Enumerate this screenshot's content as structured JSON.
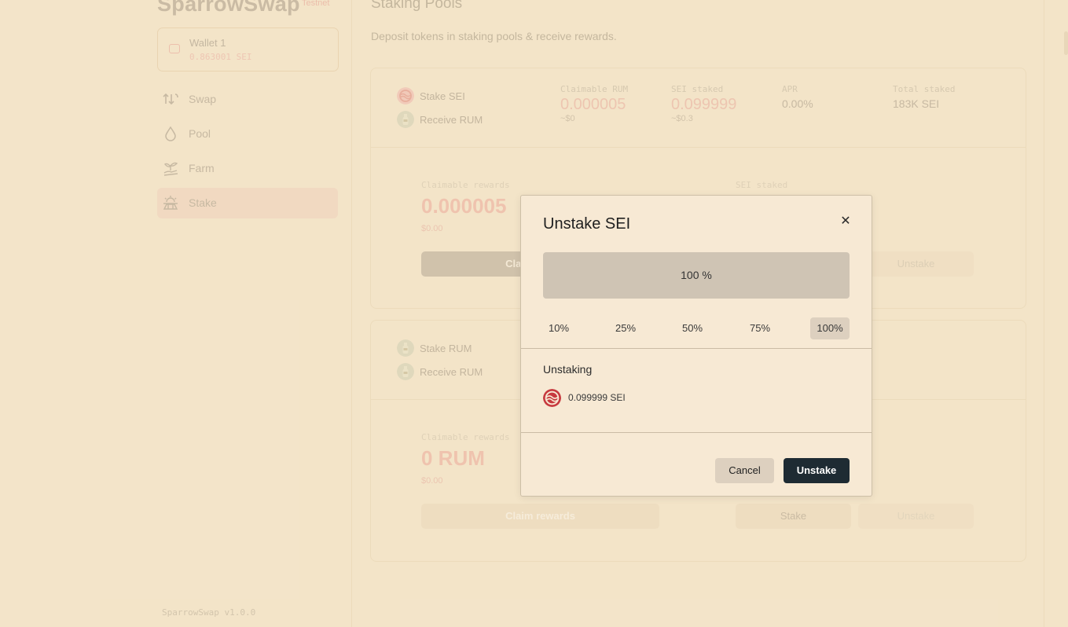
{
  "app": {
    "name": "SparrowSwap",
    "tag": "Testnet",
    "version": "SparrowSwap v1.0.0"
  },
  "wallet": {
    "name": "Wallet 1",
    "balance": "0.863001 SEI"
  },
  "nav": [
    {
      "label": "Swap",
      "icon": "swap-icon"
    },
    {
      "label": "Pool",
      "icon": "droplet-icon"
    },
    {
      "label": "Farm",
      "icon": "sprout-icon"
    },
    {
      "label": "Stake",
      "icon": "stake-icon",
      "active": true
    }
  ],
  "page": {
    "title": "Staking Pools",
    "subtitle": "Deposit tokens in staking pools & receive rewards."
  },
  "pools": [
    {
      "stake_label": "Stake SEI",
      "receive_label": "Receive RUM",
      "stats": {
        "claimable_key": "Claimable RUM",
        "claimable_val": "0.000005",
        "claimable_usd": "~$0",
        "staked_key": "SEI staked",
        "staked_val": "0.099999",
        "staked_usd": "~$0.3",
        "apr_key": "APR",
        "apr_val": "0.00%",
        "total_key": "Total staked",
        "total_val": "183K SEI"
      },
      "detail": {
        "claim_label": "Claimable rewards",
        "claim_val": "0.000005",
        "claim_usd": "$0.00",
        "staked_label": "SEI staked",
        "claim_btn": "Claim rewards",
        "unstake_btn": "Unstake"
      }
    },
    {
      "stake_label": "Stake RUM",
      "receive_label": "Receive RUM",
      "detail": {
        "claim_label": "Claimable rewards",
        "claim_val": "0 RUM",
        "claim_usd": "$0.00",
        "claim_btn": "Claim rewards",
        "stake_btn": "Stake",
        "unstake_btn": "Unstake"
      }
    }
  ],
  "modal": {
    "title": "Unstake SEI",
    "close_icon": "close-icon",
    "slider_value": "100 %",
    "percent_options": [
      "10%",
      "25%",
      "50%",
      "75%",
      "100%"
    ],
    "selected_percent": "100%",
    "unstaking_label": "Unstaking",
    "unstaking_amount": "0.099999 SEI",
    "cancel": "Cancel",
    "confirm": "Unstake"
  }
}
